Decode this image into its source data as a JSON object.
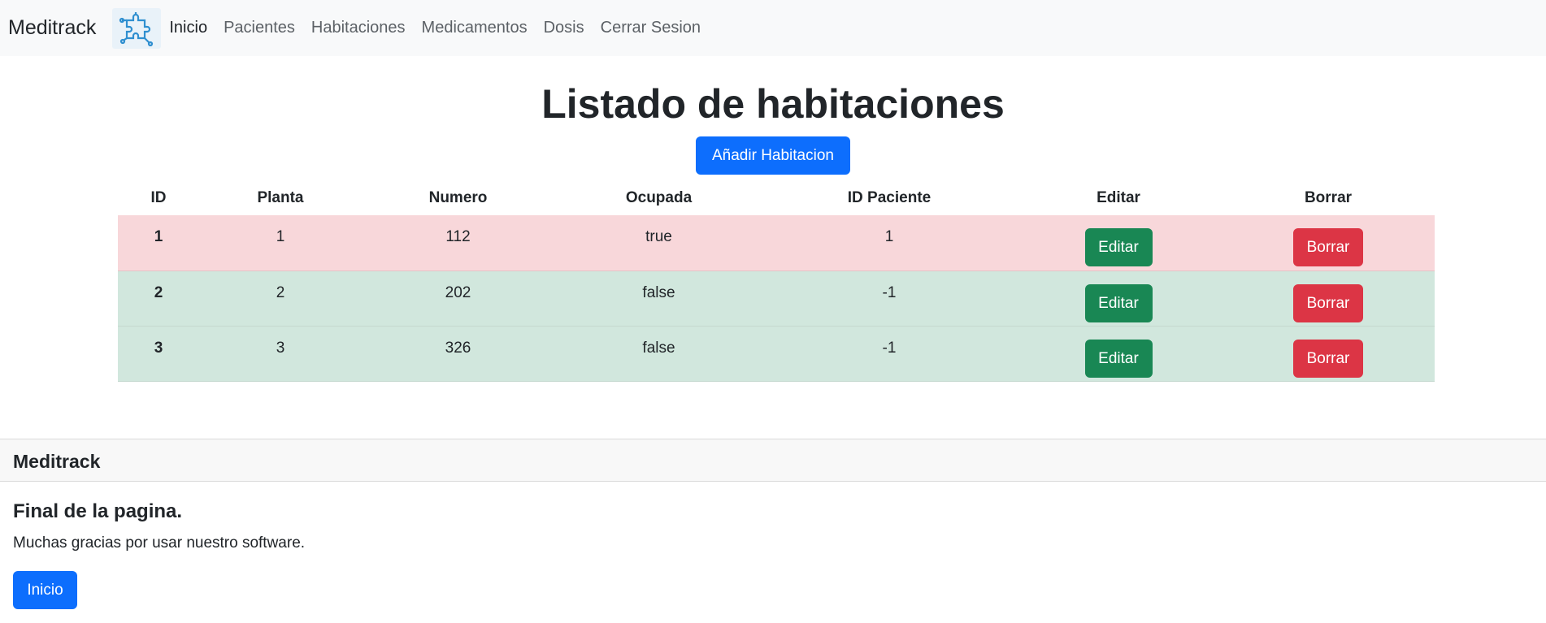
{
  "navbar": {
    "brand": "Meditrack",
    "logo_icon": "puzzle-circuit-icon",
    "links": [
      "Inicio",
      "Pacientes",
      "Habitaciones",
      "Medicamentos",
      "Dosis",
      "Cerrar Sesion"
    ]
  },
  "main": {
    "title": "Listado de habitaciones",
    "add_button": "Añadir Habitacion",
    "table": {
      "headers": [
        "ID",
        "Planta",
        "Numero",
        "Ocupada",
        "ID Paciente",
        "Editar",
        "Borrar"
      ],
      "rows": [
        {
          "id": "1",
          "planta": "1",
          "numero": "112",
          "ocupada": "true",
          "paciente": "1",
          "edit": "Editar",
          "delete": "Borrar"
        },
        {
          "id": "2",
          "planta": "2",
          "numero": "202",
          "ocupada": "false",
          "paciente": "-1",
          "edit": "Editar",
          "delete": "Borrar"
        },
        {
          "id": "3",
          "planta": "3",
          "numero": "326",
          "ocupada": "false",
          "paciente": "-1",
          "edit": "Editar",
          "delete": "Borrar"
        }
      ]
    }
  },
  "footer": {
    "header": "Meditrack",
    "title": "Final de la pagina.",
    "text": "Muchas gracias por usar nuestro software.",
    "button": "Inicio"
  },
  "colors": {
    "primary": "#0d6efd",
    "success": "#198754",
    "danger": "#dc3545",
    "row_occupied": "#f8d7da",
    "row_free": "#d1e7dd"
  }
}
